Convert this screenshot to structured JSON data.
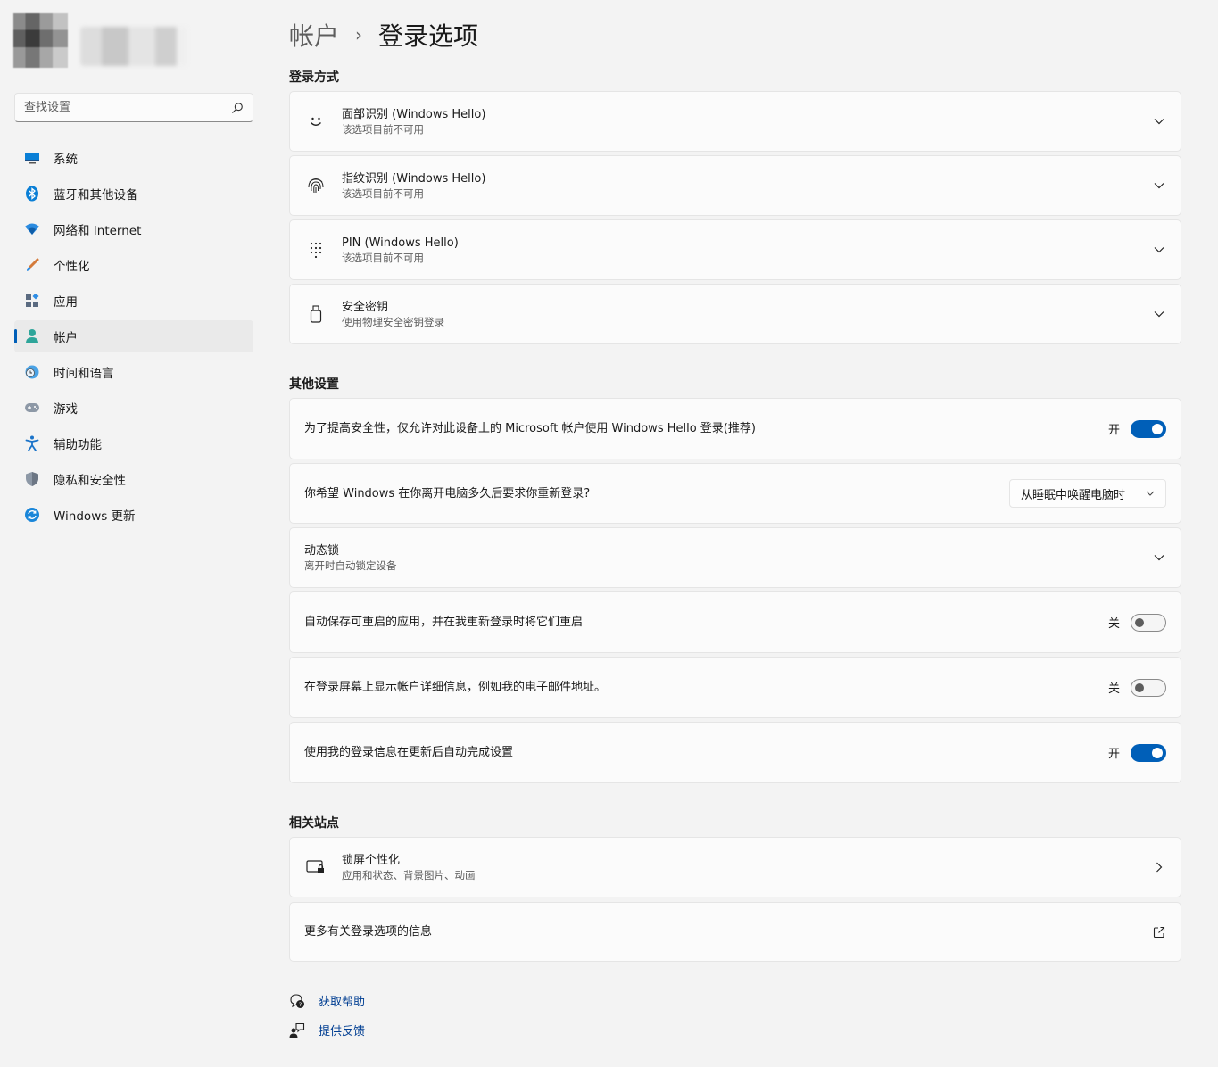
{
  "search": {
    "placeholder": "查找设置"
  },
  "sidebar": {
    "items": [
      {
        "label": "系统",
        "icon": "system-icon"
      },
      {
        "label": "蓝牙和其他设备",
        "icon": "bluetooth-icon"
      },
      {
        "label": "网络和 Internet",
        "icon": "wifi-icon"
      },
      {
        "label": "个性化",
        "icon": "brush-icon"
      },
      {
        "label": "应用",
        "icon": "apps-icon"
      },
      {
        "label": "帐户",
        "icon": "account-icon",
        "active": true
      },
      {
        "label": "时间和语言",
        "icon": "globe-clock-icon"
      },
      {
        "label": "游戏",
        "icon": "gamepad-icon"
      },
      {
        "label": "辅助功能",
        "icon": "accessibility-icon"
      },
      {
        "label": "隐私和安全性",
        "icon": "shield-icon"
      },
      {
        "label": "Windows 更新",
        "icon": "update-icon"
      }
    ]
  },
  "breadcrumb": {
    "parent": "帐户",
    "separator": "›",
    "current": "登录选项"
  },
  "signin_methods": {
    "title": "登录方式",
    "items": [
      {
        "title": "面部识别 (Windows Hello)",
        "subtitle": "该选项目前不可用",
        "icon": "face-icon"
      },
      {
        "title": "指纹识别 (Windows Hello)",
        "subtitle": "该选项目前不可用",
        "icon": "fingerprint-icon"
      },
      {
        "title": "PIN (Windows Hello)",
        "subtitle": "该选项目前不可用",
        "icon": "pin-keypad-icon"
      },
      {
        "title": "安全密钥",
        "subtitle": "使用物理安全密钥登录",
        "icon": "usb-key-icon"
      }
    ]
  },
  "other_settings": {
    "title": "其他设置",
    "hello_only": {
      "label": "为了提高安全性，仅允许对此设备上的 Microsoft 帐户使用 Windows Hello 登录(推荐)",
      "state": "开",
      "on": true
    },
    "require_signin": {
      "label": "你希望 Windows 在你离开电脑多久后要求你重新登录?",
      "value": "从睡眠中唤醒电脑时"
    },
    "dynamic_lock": {
      "title": "动态锁",
      "subtitle": "离开时自动锁定设备"
    },
    "restart_apps": {
      "label": "自动保存可重启的应用，并在我重新登录时将它们重启",
      "state": "关",
      "on": false
    },
    "show_account_details": {
      "label": "在登录屏幕上显示帐户详细信息，例如我的电子邮件地址。",
      "state": "关",
      "on": false
    },
    "use_signin_info": {
      "label": "使用我的登录信息在更新后自动完成设置",
      "state": "开",
      "on": true
    }
  },
  "related": {
    "title": "相关站点",
    "lock_screen": {
      "title": "锁屏个性化",
      "subtitle": "应用和状态、背景图片、动画"
    },
    "more_info": {
      "label": "更多有关登录选项的信息"
    }
  },
  "footer": {
    "help": "获取帮助",
    "feedback": "提供反馈"
  },
  "colors": {
    "accent": "#005fb8",
    "link": "#003e92",
    "background": "#f3f3f3",
    "card": "#fbfbfb"
  }
}
